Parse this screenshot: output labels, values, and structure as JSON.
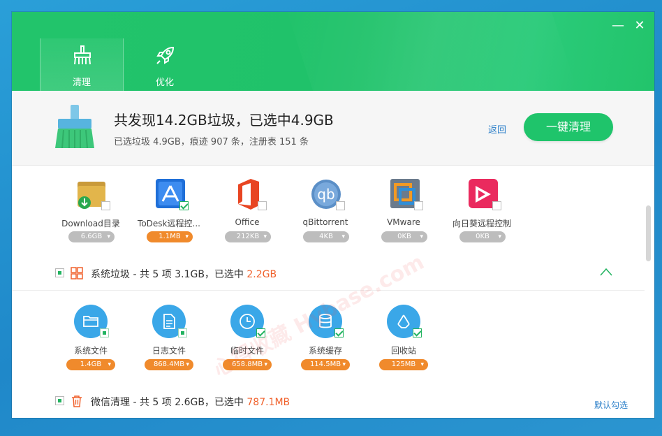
{
  "window": {
    "tabs": [
      {
        "label": "清理",
        "icon": "broom-icon"
      },
      {
        "label": "优化",
        "icon": "rocket-icon"
      }
    ],
    "controls": {
      "minimize": "—",
      "close": "✕"
    }
  },
  "summary": {
    "title": "共发现14.2GB垃圾，已选中4.9GB",
    "subtitle": "已选垃圾 4.9GB，痕迹 907 条，注册表 151 条",
    "back_label": "返回",
    "clean_button": "一键清理"
  },
  "apps": [
    {
      "name": "Download目录",
      "size": "6.6GB",
      "checked": false,
      "icon": "folder-download-icon"
    },
    {
      "name": "ToDesk远程控...",
      "size": "1.1MB",
      "checked": true,
      "icon": "todesk-icon"
    },
    {
      "name": "Office",
      "size": "212KB",
      "checked": false,
      "icon": "office-icon"
    },
    {
      "name": "qBittorrent",
      "size": "4KB",
      "checked": false,
      "icon": "qbittorrent-icon"
    },
    {
      "name": "VMware",
      "size": "0KB",
      "checked": false,
      "icon": "vmware-icon"
    },
    {
      "name": "向日葵远程控制",
      "size": "0KB",
      "checked": false,
      "icon": "sunlogin-icon"
    }
  ],
  "system_section": {
    "title_prefix": "系统垃圾 - 共 5 项 3.1GB，已选中 ",
    "selected": "2.2GB",
    "items": [
      {
        "name": "系统文件",
        "size": "1.4GB",
        "state": "partial",
        "icon": "folder-icon"
      },
      {
        "name": "日志文件",
        "size": "868.4MB",
        "state": "partial",
        "icon": "document-icon"
      },
      {
        "name": "临时文件",
        "size": "658.8MB",
        "state": "checked",
        "icon": "clock-icon"
      },
      {
        "name": "系统缓存",
        "size": "114.5MB",
        "state": "checked",
        "icon": "database-icon"
      },
      {
        "name": "回收站",
        "size": "125MB",
        "state": "checked",
        "icon": "recycle-icon"
      }
    ]
  },
  "wechat_section": {
    "title_prefix": "微信清理 - 共 5 项 2.6GB，已选中 ",
    "selected": "787.1MB"
  },
  "default_select": "默认勾选",
  "watermark": "心得收藏 Hybase.com",
  "colors": {
    "brand_green": "#1fc46b",
    "highlight_orange": "#f0612c",
    "pill_orange": "#f08a2c",
    "icon_blue": "#3aa7e8"
  }
}
